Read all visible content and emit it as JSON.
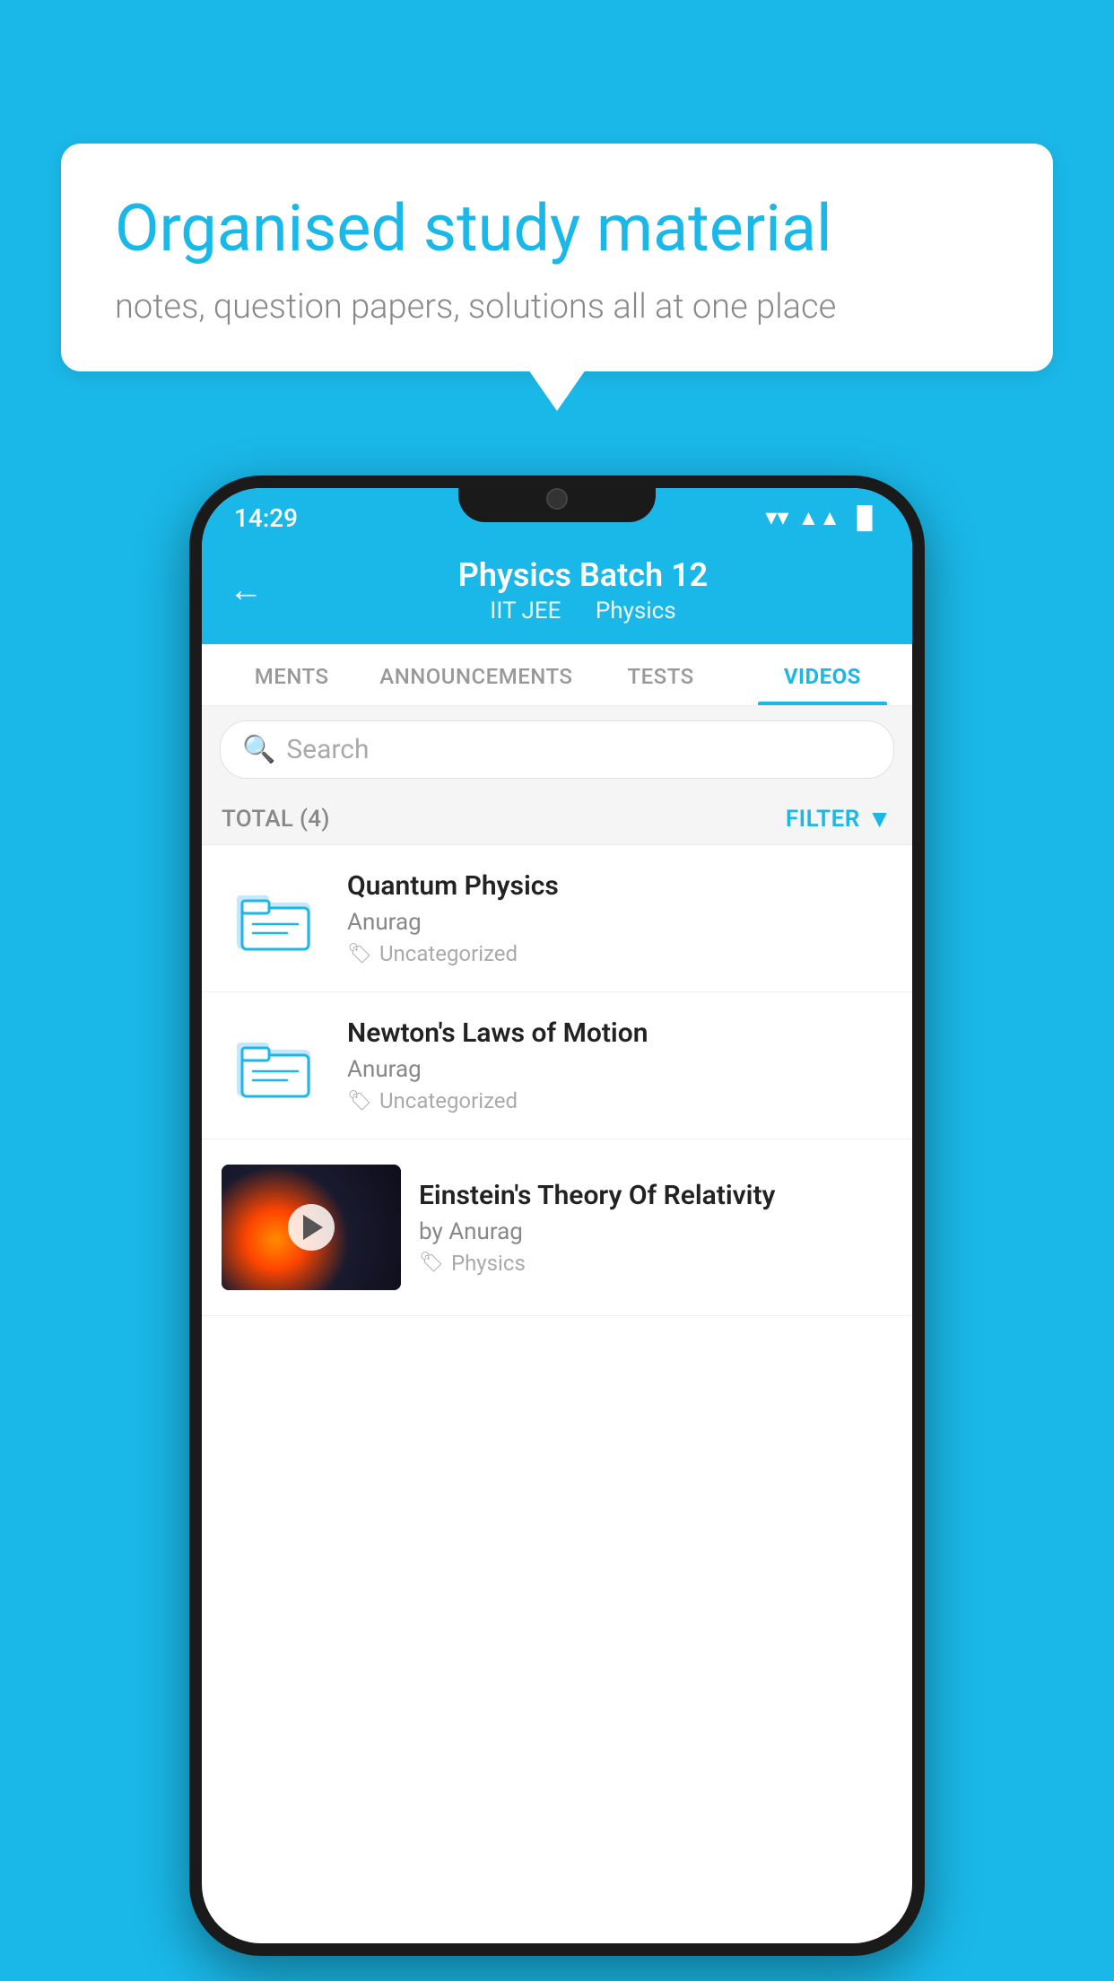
{
  "background_color": "#1ab8e8",
  "speech_bubble": {
    "title": "Organised study material",
    "subtitle": "notes, question papers, solutions all at one place"
  },
  "phone": {
    "status_bar": {
      "time": "14:29",
      "wifi": "▼",
      "signal": "▲",
      "battery": "▐"
    },
    "header": {
      "title": "Physics Batch 12",
      "subtitle_part1": "IIT JEE",
      "subtitle_part2": "Physics",
      "back_label": "←"
    },
    "tabs": [
      {
        "label": "MENTS",
        "active": false
      },
      {
        "label": "ANNOUNCEMENTS",
        "active": false
      },
      {
        "label": "TESTS",
        "active": false
      },
      {
        "label": "VIDEOS",
        "active": true
      }
    ],
    "search": {
      "placeholder": "Search"
    },
    "filter": {
      "total_label": "TOTAL (4)",
      "filter_label": "FILTER"
    },
    "videos": [
      {
        "id": 1,
        "title": "Quantum Physics",
        "author": "Anurag",
        "tag": "Uncategorized",
        "has_thumb": false,
        "thumb_type": "folder"
      },
      {
        "id": 2,
        "title": "Newton's Laws of Motion",
        "author": "Anurag",
        "tag": "Uncategorized",
        "has_thumb": false,
        "thumb_type": "folder"
      },
      {
        "id": 3,
        "title": "Einstein's Theory Of Relativity",
        "author": "by Anurag",
        "tag": "Physics",
        "has_thumb": true,
        "thumb_type": "video"
      }
    ]
  }
}
